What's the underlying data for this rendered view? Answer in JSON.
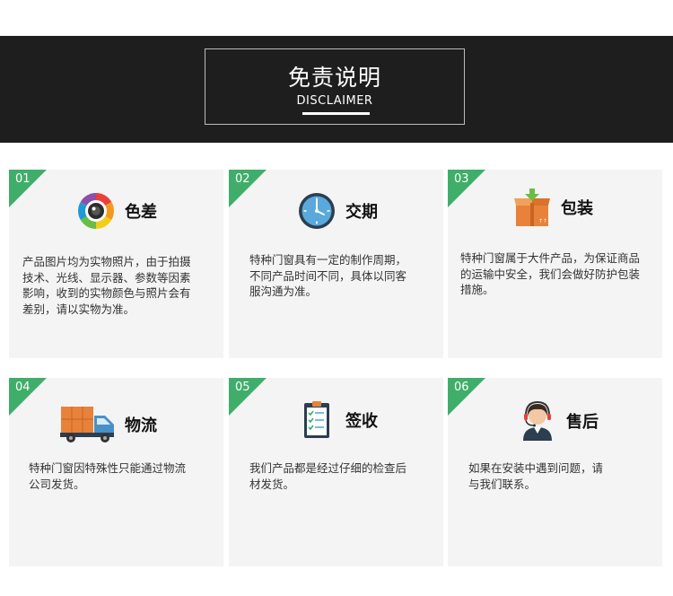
{
  "header": {
    "title": "免责说明",
    "subtitle": "DISCLAIMER"
  },
  "cards": [
    {
      "num": "01",
      "title": "色差",
      "lines": [
        "产品图片均为实物照片，由于拍摄",
        "技术、光线、显示器、参数等因素",
        "影响，收到的实物颜色与照片会有",
        "差别，请以实物为准。"
      ]
    },
    {
      "num": "02",
      "title": "交期",
      "lines": [
        "特种门窗具有一定的制作周期，",
        "不同产品时间不同，具体以同客",
        "服沟通为准。"
      ]
    },
    {
      "num": "03",
      "title": "包装",
      "lines": [
        "特种门窗属于大件产品，为保证商品",
        "的运输中安全，我们会做好防护包装",
        "措施。"
      ]
    },
    {
      "num": "04",
      "title": "物流",
      "lines": [
        "特种门窗因特殊性只能通过物流",
        "公司发货。"
      ]
    },
    {
      "num": "05",
      "title": "签收",
      "lines": [
        "我们产品都是经过仔细的检查后",
        "材发货。"
      ]
    },
    {
      "num": "06",
      "title": "售后",
      "lines": [
        "如果在安装中遇到问题，请",
        "与我们联系。"
      ]
    }
  ],
  "icons": [
    "camera-lens-icon",
    "clock-icon",
    "package-box-icon",
    "delivery-truck-icon",
    "clipboard-checklist-icon",
    "customer-service-icon"
  ],
  "colors": {
    "banner": "#1e1e1e",
    "accent": "#3fae6a",
    "card": "#f4f4f4"
  }
}
